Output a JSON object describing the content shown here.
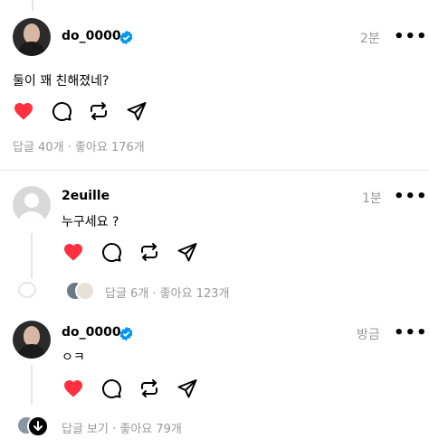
{
  "post": {
    "username": "do_0000",
    "time": "2분",
    "text": "둘이 꽤 친해졌네?",
    "meta": "답글 40개 · 좋아요 176개"
  },
  "reply1": {
    "username": "2euille",
    "time": "1분",
    "text": "누구세요 ?",
    "meta": "답글 6개 · 좋아요 123개"
  },
  "reply2": {
    "username": "do_0000",
    "time": "방금",
    "text": "ㅇㅋ",
    "meta": "답글 보기 · 좋아요 79개"
  },
  "more_label": "•••",
  "colors": {
    "like": "#ff3040",
    "verified": "#0095f6",
    "meta": "#999999"
  },
  "icons": [
    "heart-icon",
    "comment-icon",
    "repost-icon",
    "share-icon",
    "verified-icon",
    "more-icon"
  ]
}
